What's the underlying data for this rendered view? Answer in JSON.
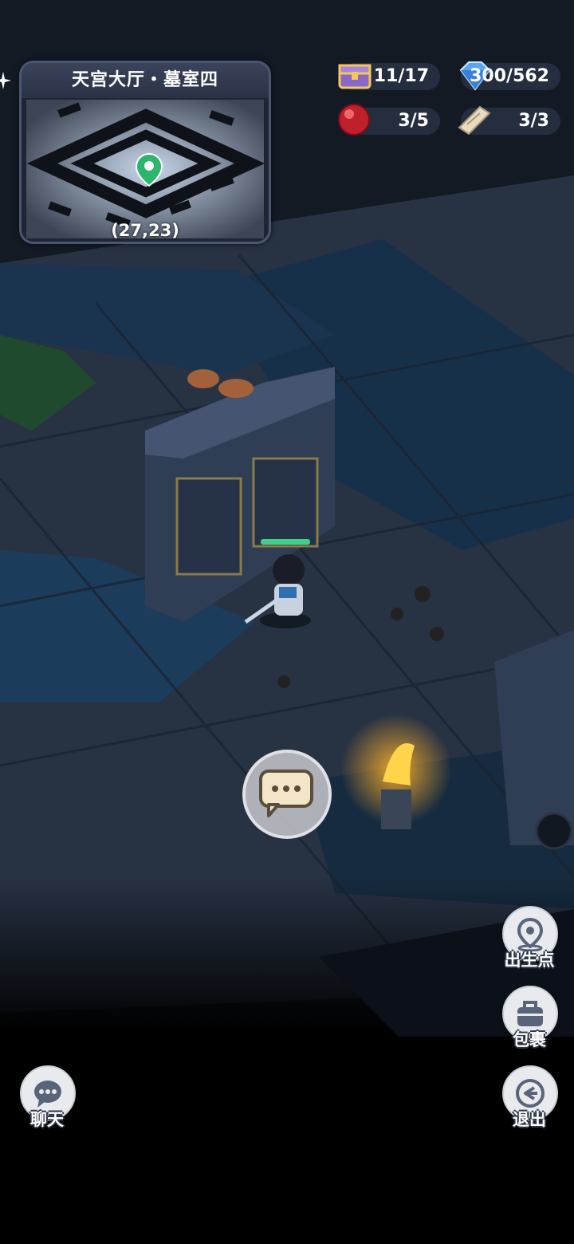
{
  "minimap": {
    "title": "天宫大厅・墓室四",
    "coords": "(27,23)"
  },
  "resources": {
    "chests": {
      "icon": "treasure-chest-icon",
      "value": "11/17"
    },
    "gems": {
      "icon": "blue-diamond-icon",
      "value": "300/562"
    },
    "orbs": {
      "icon": "red-orb-icon",
      "value": "3/5"
    },
    "scrolls": {
      "icon": "scroll-icon",
      "value": "3/3"
    }
  },
  "side_buttons": {
    "spawn": {
      "label": "出生点",
      "icon": "location-pin-icon"
    },
    "bag": {
      "label": "包裹",
      "icon": "bag-icon"
    },
    "exit": {
      "label": "退出",
      "icon": "exit-icon"
    },
    "chat": {
      "label": "聊天",
      "icon": "chat-icon"
    }
  },
  "player": {
    "hp_fraction": 1.0
  },
  "colors": {
    "accent_green": "#3fd08a",
    "panel": "#2a3245"
  }
}
